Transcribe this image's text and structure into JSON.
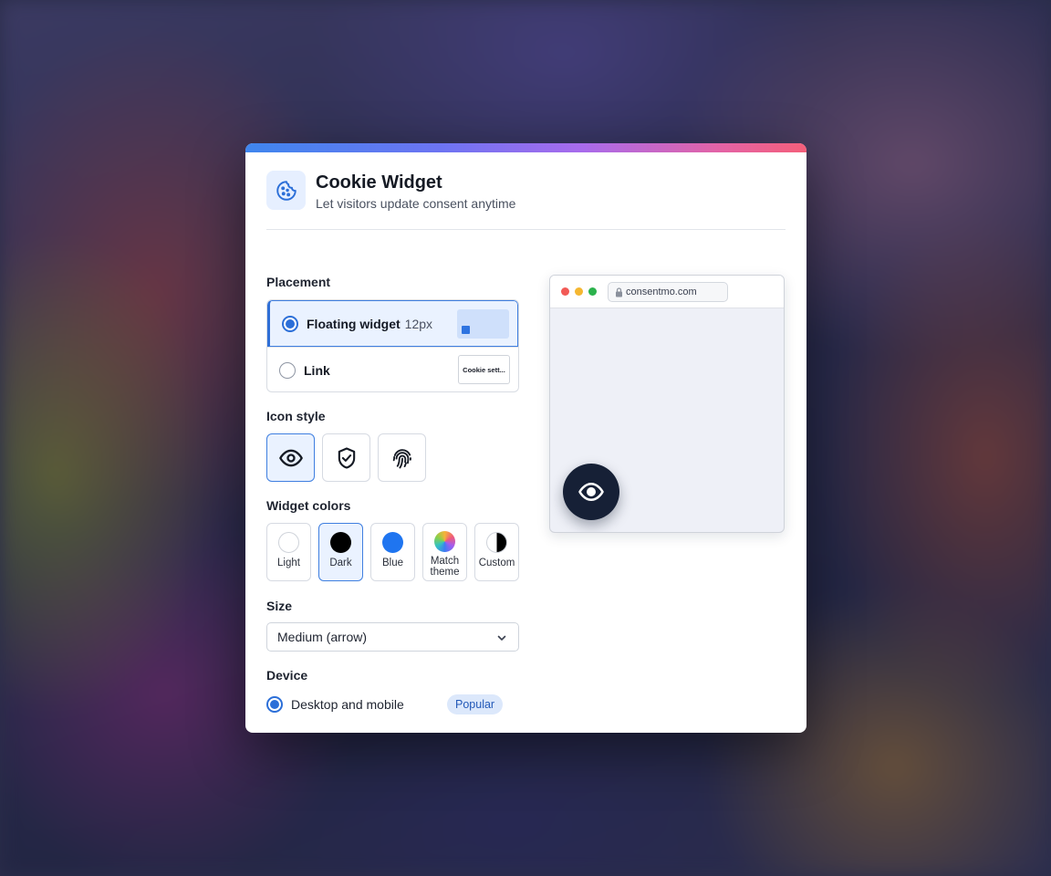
{
  "header": {
    "title": "Cookie Widget",
    "subtitle": "Let visitors update consent anytime",
    "icon": "cookie-icon"
  },
  "placement": {
    "label": "Placement",
    "options": [
      {
        "label": "Floating widget",
        "meta": "12px",
        "selected": true
      },
      {
        "label": "Link",
        "meta": "",
        "selected": false,
        "thumb_text": "Cookie sett..."
      }
    ]
  },
  "icon_style": {
    "label": "Icon style",
    "options": [
      "eye-icon",
      "shield-check-icon",
      "fingerprint-icon"
    ],
    "selected": "eye-icon"
  },
  "widget_colors": {
    "label": "Widget colors",
    "options": [
      {
        "label": "Light",
        "color": "#ffffff"
      },
      {
        "label": "Dark",
        "color": "#000000"
      },
      {
        "label": "Blue",
        "color": "#1f75f0"
      },
      {
        "label": "Match theme",
        "color": "conic-gradient"
      },
      {
        "label": "Custom",
        "color": "half-black-white"
      }
    ],
    "selected": "Dark"
  },
  "size": {
    "label": "Size",
    "value": "Medium (arrow)"
  },
  "device": {
    "label": "Device",
    "option": "Desktop and mobile",
    "badge": "Popular"
  },
  "preview": {
    "url": "consentmo.com",
    "traffic_lights": [
      "#f25a56",
      "#f5b731",
      "#2bb24c"
    ],
    "widget_color": "#162036"
  },
  "colors": {
    "accent": "#2c6fd8",
    "selected_bg": "#eaf2ff"
  }
}
